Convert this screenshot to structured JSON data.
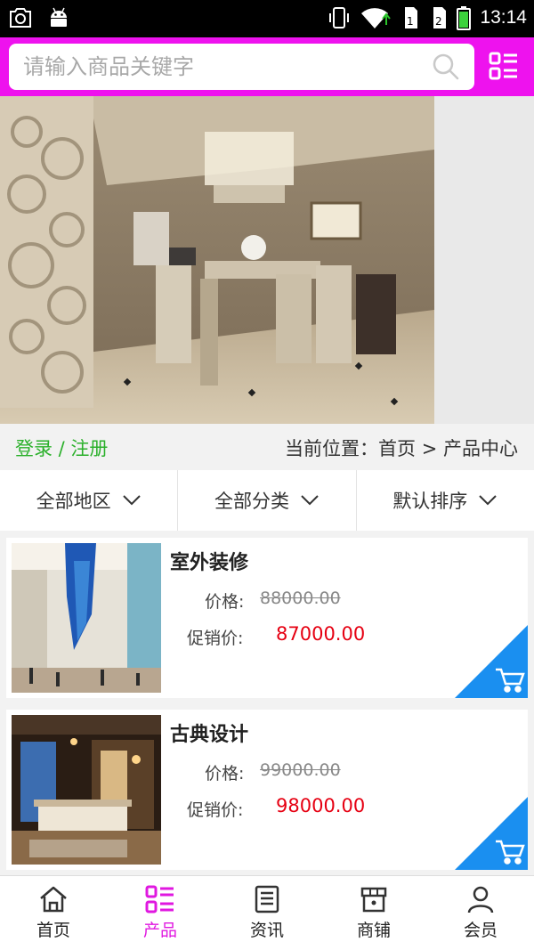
{
  "status_bar": {
    "time": "13:14",
    "icons": [
      "screenshot-icon",
      "android-icon",
      "vibrate-icon",
      "wifi-icon",
      "sim1-icon",
      "sim2-icon",
      "battery-icon"
    ]
  },
  "search": {
    "placeholder": "请输入商品关键字",
    "value": "",
    "icon": "search-icon"
  },
  "header": {
    "menu_icon": "category-grid-icon"
  },
  "colors": {
    "brand": "#ee12ee",
    "login_green": "#2bb02b",
    "promo_red": "#e60012",
    "cart_blue": "#1a8ff0"
  },
  "infobar": {
    "login_label": "登录 / 注册",
    "breadcrumb": "当前位置：首页 > 产品中心"
  },
  "filters": [
    {
      "label": "全部地区"
    },
    {
      "label": "全部分类"
    },
    {
      "label": "默认排序"
    }
  ],
  "products": [
    {
      "name": "室外装修",
      "price_label": "价格:",
      "price": "88000.00",
      "promo_label": "促销价:",
      "promo_price": "87000.00"
    },
    {
      "name": "古典设计",
      "price_label": "价格:",
      "price": "99000.00",
      "promo_label": "促销价:",
      "promo_price": "98000.00"
    }
  ],
  "nav": [
    {
      "label": "首页",
      "icon": "home-icon",
      "active": false
    },
    {
      "label": "产品",
      "icon": "product-list-icon",
      "active": true
    },
    {
      "label": "资讯",
      "icon": "news-icon",
      "active": false
    },
    {
      "label": "商铺",
      "icon": "store-icon",
      "active": false
    },
    {
      "label": "会员",
      "icon": "member-icon",
      "active": false
    }
  ]
}
